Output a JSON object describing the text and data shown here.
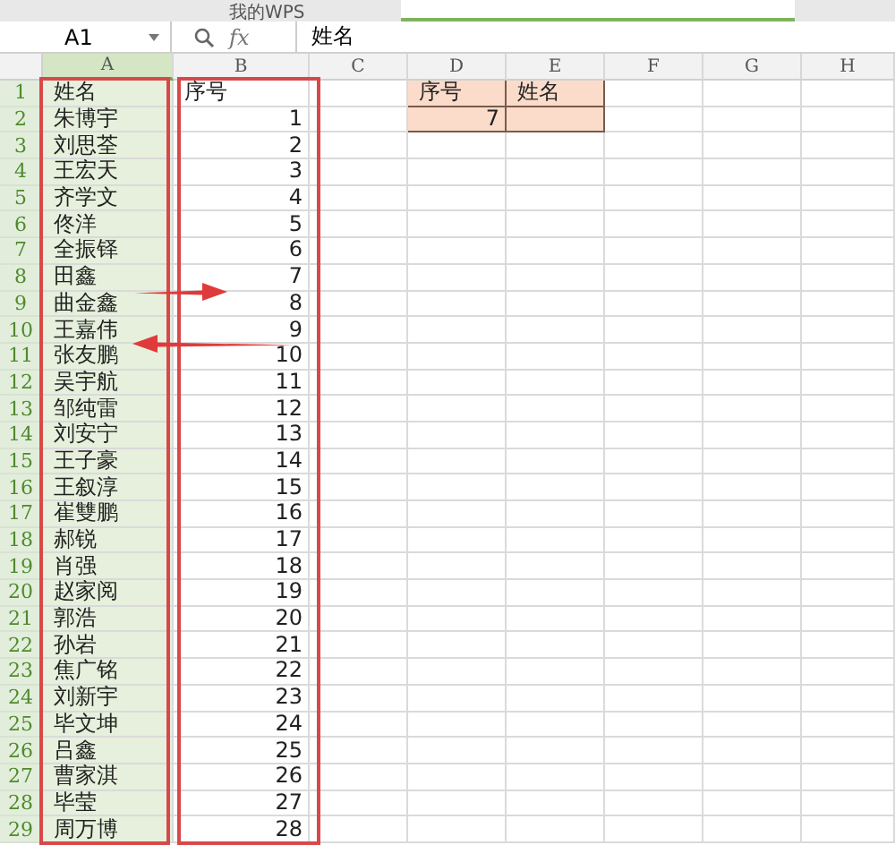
{
  "tabs": [
    {
      "label": "我的WPS",
      "selected": false
    },
    {
      "selected": true
    }
  ],
  "formula_bar": {
    "name_box": "A1",
    "function_label": "fx",
    "content": "姓名"
  },
  "columns": [
    {
      "label": "A",
      "selected": true,
      "outlined": true
    },
    {
      "label": "B",
      "selected": false,
      "outlined": true
    },
    {
      "label": "C",
      "selected": false,
      "outlined": false
    },
    {
      "label": "D",
      "selected": false,
      "outlined": false
    },
    {
      "label": "E",
      "selected": false,
      "outlined": false
    },
    {
      "label": "F",
      "selected": false,
      "outlined": false
    },
    {
      "label": "G",
      "selected": false,
      "outlined": false
    },
    {
      "label": "H",
      "selected": false,
      "outlined": false
    }
  ],
  "rows": [
    {
      "label": "1",
      "cells": [
        {
          "text": "姓名"
        },
        {
          "text": "序号"
        },
        {},
        {
          "text": "序号",
          "shaded": true
        },
        {
          "text": "姓名",
          "shaded": true
        }
      ]
    },
    {
      "label": "2",
      "cells": [
        {
          "text": "朱博宇"
        },
        {
          "text": "1"
        },
        {},
        {
          "text": "7",
          "shaded": true
        },
        {
          "shaded": true
        }
      ]
    },
    {
      "label": "3",
      "cells": [
        {
          "text": "刘思荃"
        },
        {
          "text": "2"
        }
      ]
    },
    {
      "label": "4",
      "cells": [
        {
          "text": "王宏天"
        },
        {
          "text": "3"
        }
      ]
    },
    {
      "label": "5",
      "cells": [
        {
          "text": "齐学文"
        },
        {
          "text": "4"
        }
      ]
    },
    {
      "label": "6",
      "cells": [
        {
          "text": "佟洋"
        },
        {
          "text": "5"
        }
      ]
    },
    {
      "label": "7",
      "cells": [
        {
          "text": "全振铎"
        },
        {
          "text": "6"
        }
      ]
    },
    {
      "label": "8",
      "cells": [
        {
          "text": "田鑫"
        },
        {
          "text": "7"
        }
      ]
    },
    {
      "label": "9",
      "cells": [
        {
          "text": "曲金鑫"
        },
        {
          "text": "8"
        }
      ]
    },
    {
      "label": "10",
      "cells": [
        {
          "text": "王嘉伟"
        },
        {
          "text": "9"
        }
      ]
    },
    {
      "label": "11",
      "cells": [
        {
          "text": "张友鹏"
        },
        {
          "text": "10"
        }
      ]
    },
    {
      "label": "12",
      "cells": [
        {
          "text": "吴宇航"
        },
        {
          "text": "11"
        }
      ]
    },
    {
      "label": "13",
      "cells": [
        {
          "text": "邹纯雷"
        },
        {
          "text": "12"
        }
      ]
    },
    {
      "label": "14",
      "cells": [
        {
          "text": "刘安宁"
        },
        {
          "text": "13"
        }
      ]
    },
    {
      "label": "15",
      "cells": [
        {
          "text": "王子豪"
        },
        {
          "text": "14"
        }
      ]
    },
    {
      "label": "16",
      "cells": [
        {
          "text": "王叙淳"
        },
        {
          "text": "15"
        }
      ]
    },
    {
      "label": "17",
      "cells": [
        {
          "text": "崔雙鹏"
        },
        {
          "text": "16"
        }
      ]
    },
    {
      "label": "18",
      "cells": [
        {
          "text": "郝锐"
        },
        {
          "text": "17"
        }
      ]
    },
    {
      "label": "19",
      "cells": [
        {
          "text": "肖强"
        },
        {
          "text": "18"
        }
      ]
    },
    {
      "label": "20",
      "cells": [
        {
          "text": "赵家阅"
        },
        {
          "text": "19"
        }
      ]
    },
    {
      "label": "21",
      "cells": [
        {
          "text": "郭浩"
        },
        {
          "text": "20"
        }
      ]
    },
    {
      "label": "22",
      "cells": [
        {
          "text": "孙岩"
        },
        {
          "text": "21"
        }
      ]
    },
    {
      "label": "23",
      "cells": [
        {
          "text": "焦广铭"
        },
        {
          "text": "22"
        }
      ]
    },
    {
      "label": "24",
      "cells": [
        {
          "text": "刘新宇"
        },
        {
          "text": "23"
        }
      ]
    },
    {
      "label": "25",
      "cells": [
        {
          "text": "毕文坤"
        },
        {
          "text": "24"
        }
      ]
    },
    {
      "label": "26",
      "cells": [
        {
          "text": "吕鑫"
        },
        {
          "text": "25"
        }
      ]
    },
    {
      "label": "27",
      "cells": [
        {
          "text": "曹家淇"
        },
        {
          "text": "26"
        }
      ]
    },
    {
      "label": "28",
      "cells": [
        {
          "text": "毕莹"
        },
        {
          "text": "27"
        }
      ]
    },
    {
      "label": "29",
      "cells": [
        {
          "text": "周万博"
        },
        {
          "text": "28"
        }
      ]
    }
  ]
}
